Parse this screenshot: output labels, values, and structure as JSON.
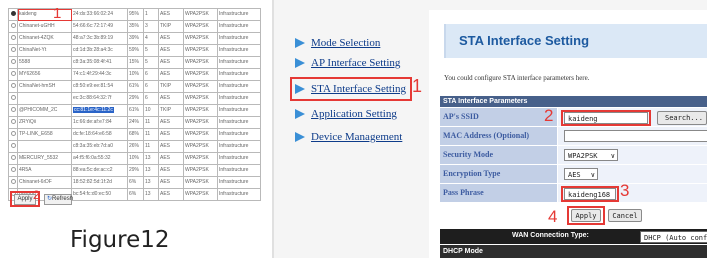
{
  "survey": {
    "rows": [
      {
        "ssid": "kaideng",
        "mac": "24:ds:33:66:02:24",
        "signal": "95%",
        "channel": "1",
        "enc": "AES",
        "auth": "WPA2PSK",
        "mode": "Infrastructure",
        "checked": true
      },
      {
        "ssid": "Chinanet-uGHH",
        "mac": "54:66:6c:72:17:49",
        "signal": "35%",
        "channel": "3",
        "enc": "TKIP",
        "auth": "WPA2PSK",
        "mode": "Infrastructure"
      },
      {
        "ssid": "Chinanet-4ZQK",
        "mac": "48:a7:3c:3b:89:19",
        "signal": "39%",
        "channel": "4",
        "enc": "AES",
        "auth": "WPA2PSK",
        "mode": "Infrastructure"
      },
      {
        "ssid": "ChinaNet-Yt",
        "mac": "cd:1d:3b:28:a4:3c",
        "signal": "59%",
        "channel": "5",
        "enc": "AES",
        "auth": "WPA2PSK",
        "mode": "Infrastructure"
      },
      {
        "ssid": "5588",
        "mac": "c8:3a:35:08:4f:41",
        "signal": "15%",
        "channel": "5",
        "enc": "AES",
        "auth": "WPA2PSK",
        "mode": "Infrastructure"
      },
      {
        "ssid": "MY62656",
        "mac": "74:c1:4f:29:44:3c",
        "signal": "10%",
        "channel": "6",
        "enc": "AES",
        "auth": "WPA2PSK",
        "mode": "Infrastructure"
      },
      {
        "ssid": "ChinaNet-hmSH",
        "mac": "c8:50:e9:ee:81:54",
        "signal": "61%",
        "channel": "6",
        "enc": "TKIP",
        "auth": "WPA2PSK",
        "mode": "Infrastructure"
      },
      {
        "ssid": "",
        "mac": "ec:3c:88:64:32:7f",
        "signal": "29%",
        "channel": "6",
        "enc": "AES",
        "auth": "WPA2PSK",
        "mode": "Infrastructure"
      },
      {
        "ssid": "@PHICOMM_2C",
        "mac": "cc:81:1e:4c:11:2c",
        "signal": "61%",
        "channel": "10",
        "enc": "TKIP",
        "auth": "WPA2PSK",
        "mode": "Infrastructure",
        "hl": true
      },
      {
        "ssid": "ZRYiQii",
        "mac": "1c:66:de:af:e7:84",
        "signal": "24%",
        "channel": "11",
        "enc": "AES",
        "auth": "WPA2PSK",
        "mode": "Infrastructure"
      },
      {
        "ssid": "TP-LINK_E658",
        "mac": "dc:fe:18:64:e6:58",
        "signal": "68%",
        "channel": "11",
        "enc": "AES",
        "auth": "WPA2PSK",
        "mode": "Infrastructure"
      },
      {
        "ssid": "",
        "mac": "c8:3a:35:eb:7d:a0",
        "signal": "26%",
        "channel": "11",
        "enc": "AES",
        "auth": "WPA2PSK",
        "mode": "Infrastructure"
      },
      {
        "ssid": "MERCURY_5532",
        "mac": "a4:f5:f6:0a:55:32",
        "signal": "10%",
        "channel": "13",
        "enc": "AES",
        "auth": "WPA2PSK",
        "mode": "Infrastructure"
      },
      {
        "ssid": "4R5A",
        "mac": "88:ea:5c:de:ac:c2",
        "signal": "29%",
        "channel": "13",
        "enc": "AES",
        "auth": "WPA2PSK",
        "mode": "Infrastructure"
      },
      {
        "ssid": "Chinanet-6rDF",
        "mac": "18:52:82:5d:1f:2d",
        "signal": "6%",
        "channel": "13",
        "enc": "AES",
        "auth": "WPA2PSK",
        "mode": "Infrastructure"
      },
      {
        "ssid": "888888",
        "mac": "bc:54:fc:d0:ec:50",
        "signal": "6%",
        "channel": "13",
        "enc": "AES",
        "auth": "WPA2PSK",
        "mode": "Infrastructure"
      }
    ],
    "apply_label": "Apply",
    "refresh_label": "Refresh",
    "step1": "1",
    "step2": "2",
    "figure_caption": "Figure12"
  },
  "panel": {
    "nav": [
      {
        "label": "Mode Selection"
      },
      {
        "label": "AP Interface Setting"
      },
      {
        "label": "STA Interface Setting"
      },
      {
        "label": "Application Setting"
      },
      {
        "label": "Device Management"
      }
    ],
    "nav_step": "1",
    "title": "STA Interface Setting",
    "description": "You could configure STA interface parameters here.",
    "section_title": "STA Interface Parameters",
    "fields": {
      "ssid_label": "AP's SSID",
      "ssid_value": "kaideng",
      "search_button": "Search...",
      "mac_label": "MAC Address (Optional)",
      "mac_value": "",
      "security_label": "Security Mode",
      "security_value": "WPA2PSK",
      "encryption_label": "Encryption Type",
      "encryption_value": "AES",
      "pass_label": "Pass Phrase",
      "pass_value": "kaideng168"
    },
    "step_ssid": "2",
    "step_pass": "3",
    "step_apply": "4",
    "apply_button": "Apply",
    "cancel_button": "Cancel",
    "wan_label": "WAN Connection Type:",
    "wan_value": "DHCP (Auto config",
    "dhcp_title": "DHCP Mode"
  },
  "colors": {
    "accent_red": "#e53935",
    "header_blue": "#47608a",
    "label_bg": "#c2cfe6",
    "title_blue": "#1d5aa0"
  },
  "icons": [
    "radio-icon",
    "refresh-icon",
    "arrow-icon",
    "dropdown-icon"
  ]
}
